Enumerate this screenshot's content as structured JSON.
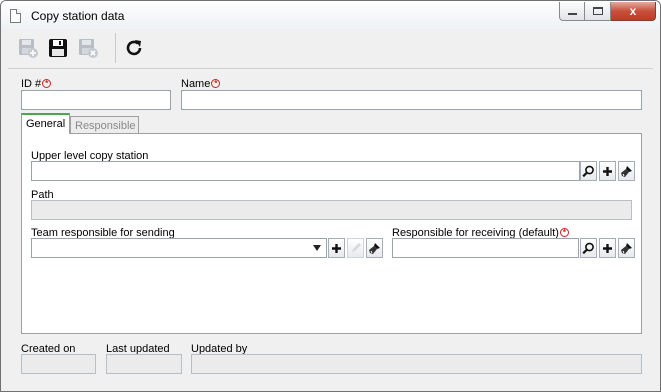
{
  "window": {
    "title": "Copy station data",
    "buttons": {
      "minimize": "minimize",
      "maximize": "maximize",
      "close": "x"
    }
  },
  "toolbar": {
    "items": [
      {
        "name": "save-and-new-icon",
        "enabled": false
      },
      {
        "name": "save-icon",
        "enabled": true
      },
      {
        "name": "save-and-exit-icon",
        "enabled": false
      },
      {
        "name": "refresh-icon",
        "enabled": true
      }
    ]
  },
  "form": {
    "id_label": "ID #",
    "id_value": "",
    "name_label": "Name",
    "name_value": ""
  },
  "tabs": {
    "general": "General",
    "responsible": "Responsible"
  },
  "general": {
    "upper_level_label": "Upper level copy station",
    "upper_level_value": "",
    "path_label": "Path",
    "path_value": "",
    "team_sending_label": "Team responsible for sending",
    "team_sending_value": "",
    "receiving_label": "Responsible for receiving (default)",
    "receiving_value": ""
  },
  "footer": {
    "created_on_label": "Created on",
    "created_on_value": "",
    "last_updated_label": "Last updated",
    "last_updated_value": "",
    "updated_by_label": "Updated by",
    "updated_by_value": ""
  },
  "colors": {
    "required": "#d42020",
    "active_tab_accent": "#4aa84a",
    "close_button": "#c8503c"
  }
}
